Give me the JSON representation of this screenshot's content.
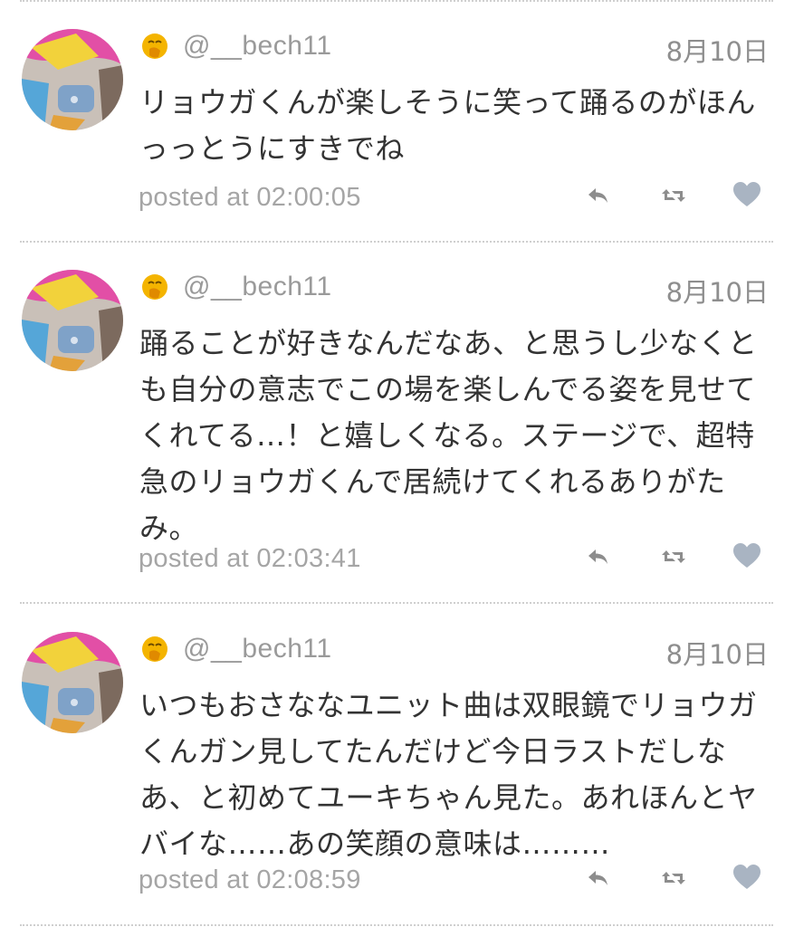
{
  "tweets": [
    {
      "handle": "@__bech11",
      "date": "8月10日",
      "text": "リョウガくんが楽しそうに笑って踊るのがほんっっとうにすきでね",
      "posted": "posted at 02:00:05"
    },
    {
      "handle": "@__bech11",
      "date": "8月10日",
      "text": "踊ることが好きなんだなあ、と思うし少なくとも自分の意志でこの場を楽しんでる姿を見せてくれてる…！と嬉しくなる。ステージで、超特急のリョウガくんで居続けてくれるありがたみ。",
      "posted": "posted at 02:03:41"
    },
    {
      "handle": "@__bech11",
      "date": "8月10日",
      "text": "いつもおさななユニット曲は双眼鏡でリョウガくんガン見してたんだけど今日ラストだしなあ、と初めてユーキちゃん見た。あれほんとヤバイな……あの笑顔の意味は………",
      "posted": "posted at 02:08:59"
    }
  ],
  "icons": {
    "emoji": "hand-over-mouth-emoji-icon",
    "reply": "reply-icon",
    "retweet": "retweet-icon",
    "like": "heart-icon"
  },
  "colors": {
    "divider": "#cfcfcf",
    "handle": "#9a9a9a",
    "meta": "#a5a5a5",
    "action": "#8d8d8d",
    "heart": "#a9b4c2",
    "emoji": "#f4b400"
  }
}
